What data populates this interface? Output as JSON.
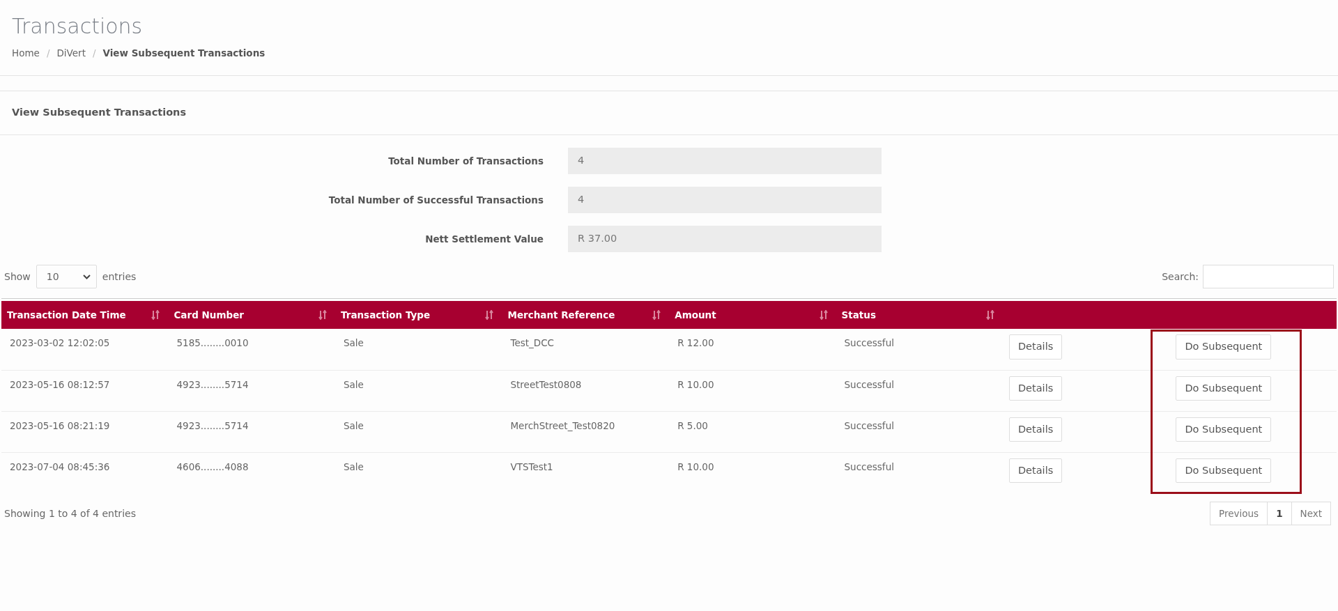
{
  "page_title": "Transactions",
  "breadcrumb": [
    {
      "label": "Home",
      "current": false
    },
    {
      "separator": "/",
      "label": "DiVert",
      "current": false
    },
    {
      "separator": "/",
      "label": "View Subsequent Transactions",
      "current": true
    }
  ],
  "panel": {
    "title": "View Subsequent Transactions",
    "summary": [
      {
        "label": "Total Number of Transactions",
        "value": "4"
      },
      {
        "label": "Total Number of Successful Transactions",
        "value": "4"
      },
      {
        "label": "Nett Settlement Value",
        "value": "R 37.00"
      }
    ],
    "length": {
      "before": "Show",
      "value": "10",
      "after": "entries"
    },
    "search": {
      "label": "Search:"
    },
    "table": {
      "columns": [
        {
          "label": "Transaction Date Time",
          "sortable": true
        },
        {
          "label": "Card Number",
          "sortable": true
        },
        {
          "label": "Transaction Type",
          "sortable": true
        },
        {
          "label": "Merchant Reference",
          "sortable": true
        },
        {
          "label": "Amount",
          "sortable": true
        },
        {
          "label": "Status",
          "sortable": true
        },
        {
          "sortable": false
        },
        {
          "sortable": false
        }
      ],
      "rows": [
        {
          "cells": [
            "2023-03-02 12:02:05",
            "5185........0010",
            "Sale",
            "Test_DCC",
            "R 12.00",
            "Successful"
          ],
          "actions": [
            "Details",
            "Do Subsequent"
          ]
        },
        {
          "cells": [
            "2023-05-16 08:12:57",
            "4923........5714",
            "Sale",
            "StreetTest0808",
            "R 10.00",
            "Successful"
          ],
          "actions": [
            "Details",
            "Do Subsequent"
          ]
        },
        {
          "cells": [
            "2023-05-16 08:21:19",
            "4923........5714",
            "Sale",
            "MerchStreet_Test0820",
            "R 5.00",
            "Successful"
          ],
          "actions": [
            "Details",
            "Do Subsequent"
          ]
        },
        {
          "cells": [
            "2023-07-04 08:45:36",
            "4606........4088",
            "Sale",
            "VTSTest1",
            "R 10.00",
            "Successful"
          ],
          "actions": [
            "Details",
            "Do Subsequent"
          ]
        }
      ]
    },
    "highlight_frame": {
      "color": "#9b0e1a"
    },
    "info": "Showing 1 to 4 of 4 entries",
    "pagination": [
      {
        "label": "Previous",
        "selected": false
      },
      {
        "label": "1",
        "selected": true
      },
      {
        "label": "Next",
        "selected": false
      }
    ]
  }
}
